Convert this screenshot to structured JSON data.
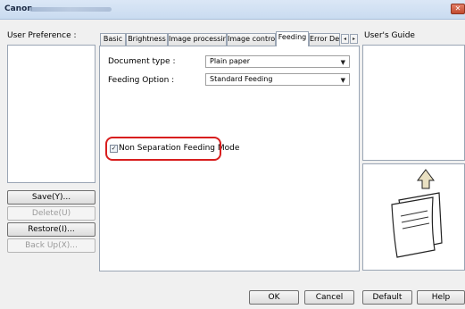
{
  "window": {
    "title_brand": "Canon",
    "close_glyph": "✕"
  },
  "left": {
    "user_preference_label": "User Preference :",
    "buttons": {
      "save": "Save(Y)...",
      "delete": "Delete(U)",
      "restore": "Restore(I)...",
      "backup": "Back Up(X)..."
    }
  },
  "tabs": [
    {
      "label": "Basic"
    },
    {
      "label": "Brightness"
    },
    {
      "label": "Image processing"
    },
    {
      "label": "Image control"
    },
    {
      "label": "Feeding",
      "active": true
    },
    {
      "label": "Error De"
    }
  ],
  "tab_scroll": {
    "left": "◂",
    "right": "▸"
  },
  "feeding": {
    "document_type_label": "Document type :",
    "document_type_value": "Plain paper",
    "feeding_option_label": "Feeding Option :",
    "feeding_option_value": "Standard Feeding",
    "non_separation_label": "Non Separation Feeding Mode",
    "non_separation_checked": true,
    "check_glyph": "✓",
    "dropdown_glyph": "▼"
  },
  "right": {
    "users_guide_label": "User's Guide",
    "illustration_icon": "paper-feed-illustration-icon"
  },
  "footer": {
    "ok": "OK",
    "cancel": "Cancel",
    "default": "Default",
    "help": "Help"
  },
  "colors": {
    "highlight": "#d81e1e",
    "arrow_fill": "#e9e0c2"
  }
}
